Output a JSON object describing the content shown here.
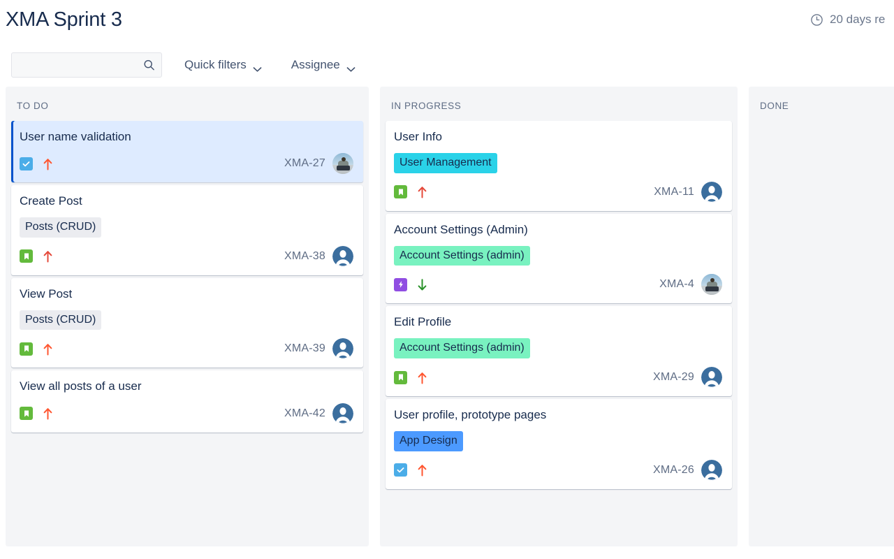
{
  "header": {
    "title": "XMA Sprint 3",
    "sprint_status": "20 days re",
    "clock_icon": "clock-icon"
  },
  "toolbar": {
    "search_value": "",
    "search_placeholder": "",
    "search_icon": "search-icon",
    "quick_filters_label": "Quick filters",
    "assignee_label": "Assignee",
    "chevron_icon": "chevron-down-icon"
  },
  "colors": {
    "selected_card_bg": "#deebff",
    "selected_card_border": "#0052cc",
    "column_bg": "#f4f5f7",
    "card_bg": "#ffffff",
    "text_primary": "#172b4d",
    "text_muted": "#5e6c84",
    "type_task": "#4bade8",
    "type_story": "#63ba3c",
    "type_epic": "#904ee2",
    "priority_high": "#ff5630",
    "priority_highest": "#e5493a",
    "priority_low": "#2a922a",
    "label_user_management": "#2ad2e8",
    "label_account_settings": "#79f2c0",
    "label_app_design": "#4c9aff",
    "label_posts_crud": "#ebecf0"
  },
  "columns": [
    {
      "name": "TO DO",
      "cards": [
        {
          "title": "User name validation",
          "labels": [],
          "type": "task",
          "type_icon": "task-checkbox-icon",
          "priority": "high",
          "priority_icon": "arrow-up-icon",
          "key": "XMA-27",
          "avatar": "photo",
          "selected": true
        },
        {
          "title": "Create Post",
          "labels": [
            {
              "text": "Posts (CRUD)",
              "color": "#ebecf0"
            }
          ],
          "type": "story",
          "type_icon": "story-bookmark-icon",
          "priority": "highest",
          "priority_icon": "arrow-up-icon",
          "key": "XMA-38",
          "avatar": "default",
          "selected": false
        },
        {
          "title": "View Post",
          "labels": [
            {
              "text": "Posts (CRUD)",
              "color": "#ebecf0"
            }
          ],
          "type": "story",
          "type_icon": "story-bookmark-icon",
          "priority": "high",
          "priority_icon": "arrow-up-icon",
          "key": "XMA-39",
          "avatar": "default",
          "selected": false
        },
        {
          "title": "View all posts of a user",
          "labels": [],
          "type": "story",
          "type_icon": "story-bookmark-icon",
          "priority": "high",
          "priority_icon": "arrow-up-icon",
          "key": "XMA-42",
          "avatar": "default",
          "selected": false
        }
      ]
    },
    {
      "name": "IN PROGRESS",
      "cards": [
        {
          "title": "User Info",
          "labels": [
            {
              "text": "User Management",
              "color": "#2ad2e8"
            }
          ],
          "type": "story",
          "type_icon": "story-bookmark-icon",
          "priority": "highest",
          "priority_icon": "arrow-up-icon",
          "key": "XMA-11",
          "avatar": "default",
          "selected": false
        },
        {
          "title": "Account Settings (Admin)",
          "labels": [
            {
              "text": "Account Settings (admin)",
              "color": "#79f2c0"
            }
          ],
          "type": "epic",
          "type_icon": "epic-bolt-icon",
          "priority": "low",
          "priority_icon": "arrow-down-icon",
          "key": "XMA-4",
          "avatar": "photo",
          "selected": false
        },
        {
          "title": "Edit Profile",
          "labels": [
            {
              "text": "Account Settings (admin)",
              "color": "#79f2c0"
            }
          ],
          "type": "story",
          "type_icon": "story-bookmark-icon",
          "priority": "high",
          "priority_icon": "arrow-up-icon",
          "key": "XMA-29",
          "avatar": "default",
          "selected": false
        },
        {
          "title": "User profile, prototype pages",
          "labels": [
            {
              "text": "App Design",
              "color": "#4c9aff"
            }
          ],
          "type": "task",
          "type_icon": "task-checkbox-icon",
          "priority": "high",
          "priority_icon": "arrow-up-icon",
          "key": "XMA-26",
          "avatar": "default",
          "selected": false
        }
      ]
    },
    {
      "name": "DONE",
      "cards": []
    }
  ]
}
